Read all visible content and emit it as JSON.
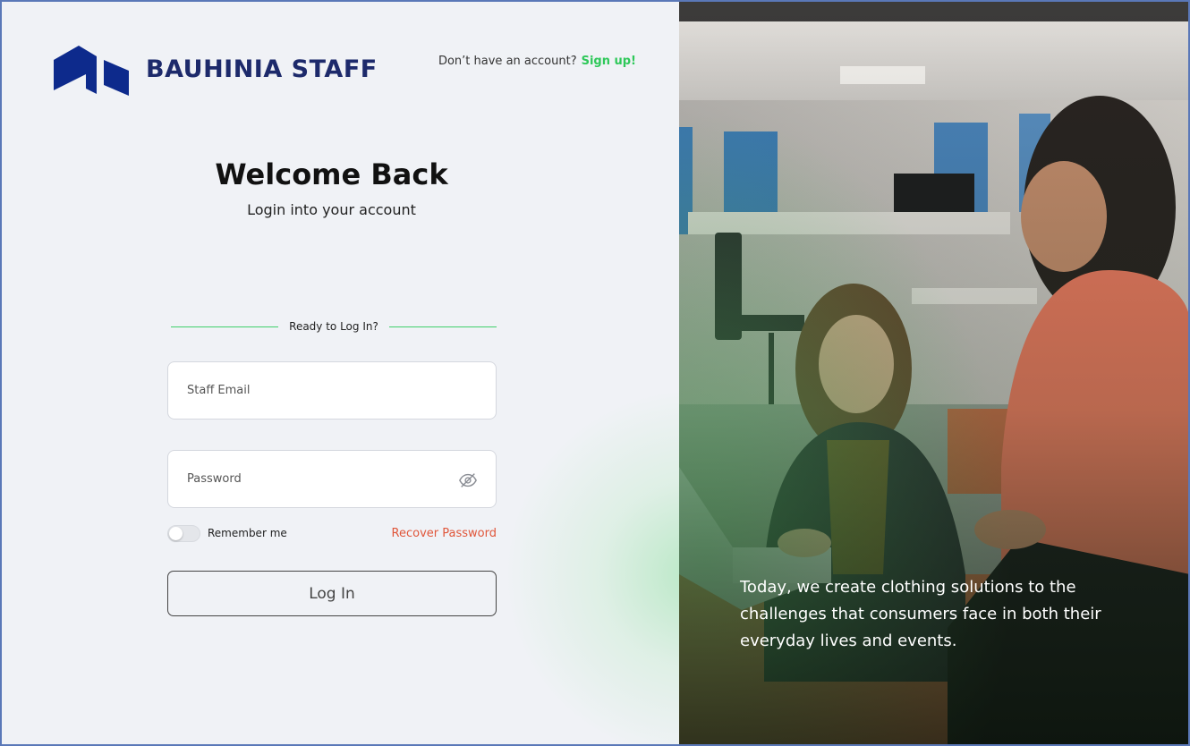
{
  "brand": {
    "name": "BAUHINIA STAFF",
    "logo_icon": "bauhinia-logo-icon",
    "color": "#1d2a6b"
  },
  "signup": {
    "prompt": "Don’t have an account?",
    "link": "Sign up!",
    "link_color": "#2fc85a"
  },
  "heading": {
    "title": "Welcome Back",
    "subtitle": "Login into your account"
  },
  "divider": {
    "label": "Ready to Log In?",
    "line_color": "#3fd06a"
  },
  "form": {
    "email_placeholder": "Staff Email",
    "password_placeholder": "Password",
    "password_toggle_icon": "eye-slash-icon",
    "remember_label": "Remember me",
    "remember_checked": false,
    "recover_label": "Recover Password",
    "recover_color": "#e0563a",
    "login_label": "Log In"
  },
  "hero": {
    "caption": "Today, we create clothing solutions to the challenges that consumers face in both their everyday lives and events."
  }
}
